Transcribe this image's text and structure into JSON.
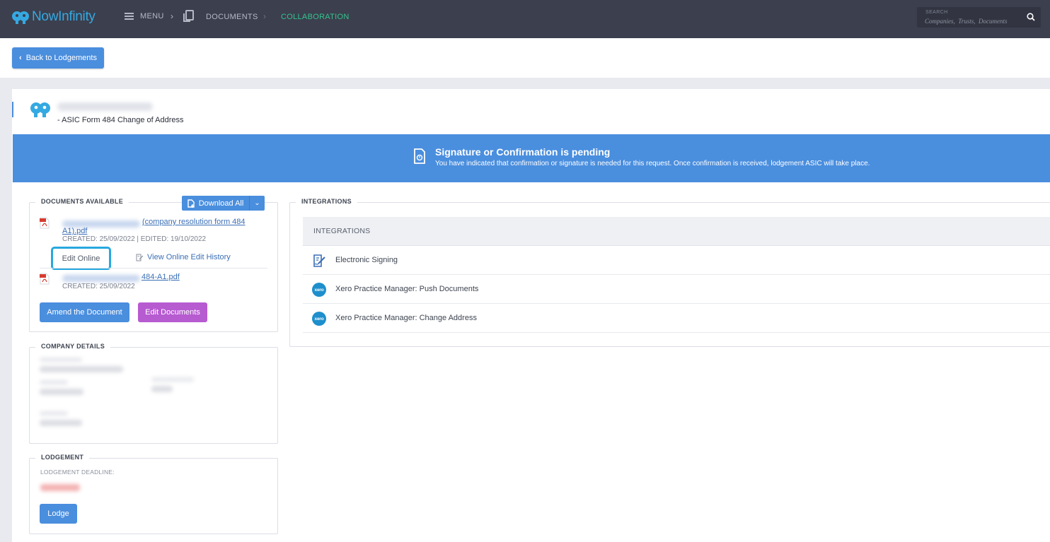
{
  "app": {
    "logo_text": "NowInfinity",
    "brand_color": "#35a9e1"
  },
  "topbar": {
    "menu_label": "MENU",
    "breadcrumb": [
      "DOCUMENTS",
      "COLLABORATION"
    ],
    "search_label": "SEARCH",
    "search_placeholder": "Companies,  Trusts,  Documents"
  },
  "subbar": {
    "back_label": "Back to Lodgements"
  },
  "entity": {
    "form_title": "- ASIC Form 484 Change of Address"
  },
  "banner": {
    "title": "Signature or Confirmation is pending",
    "message": "You have indicated that confirmation or signature is needed for this request. Once confirmation is received, lodgement ASIC will take place.",
    "color": "#4a8ede"
  },
  "documents": {
    "legend": "DOCUMENTS AVAILABLE",
    "download_all_label": "Download All",
    "items": [
      {
        "link_visible_line1": "(company resolution form 484",
        "link_visible_line2": "A1).pdf",
        "meta": "CREATED: 25/09/2022 | EDITED: 19/10/2022",
        "edit_online_label": "Edit Online",
        "edit_history_label": "View Online Edit History"
      },
      {
        "link_visible": "484-A1.pdf",
        "meta": "CREATED: 25/09/2022"
      }
    ],
    "amend_label": "Amend the Document",
    "edit_documents_label": "Edit Documents"
  },
  "company_details": {
    "legend": "COMPANY DETAILS"
  },
  "lodgement": {
    "legend": "LODGEMENT",
    "deadline_label": "LODGEMENT DEADLINE:",
    "lodge_label": "Lodge"
  },
  "integrations": {
    "legend": "INTEGRATIONS",
    "header": "INTEGRATIONS",
    "items": [
      {
        "label": "Electronic Signing",
        "icon": "signature-icon"
      },
      {
        "label": "Xero Practice Manager: Push Documents",
        "icon": "xero-icon"
      },
      {
        "label": "Xero Practice Manager: Change Address",
        "icon": "xero-icon"
      }
    ],
    "xero_icon_text": "xero"
  }
}
